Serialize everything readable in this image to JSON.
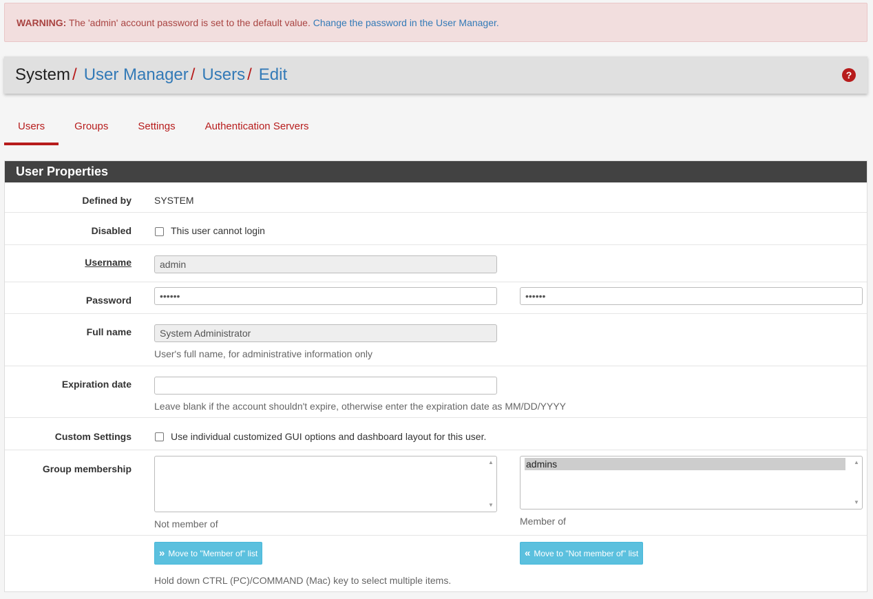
{
  "alert": {
    "prefix": "WARNING:",
    "message": " The 'admin' account password is set to the default value. ",
    "link": "Change the password in the User Manager."
  },
  "breadcrumb": {
    "root": "System",
    "sep": "/",
    "items": [
      "User Manager",
      "Users",
      "Edit"
    ]
  },
  "help_icon": "question-circle-icon",
  "tabs": [
    "Users",
    "Groups",
    "Settings",
    "Authentication Servers"
  ],
  "panel": {
    "title": "User Properties",
    "defined_by": {
      "label": "Defined by",
      "value": "SYSTEM"
    },
    "disabled": {
      "label": "Disabled",
      "checkbox_label": "This user cannot login",
      "checked": false
    },
    "username": {
      "label": "Username",
      "value": "admin"
    },
    "password": {
      "label": "Password",
      "value": "••••••",
      "confirm": "••••••"
    },
    "full_name": {
      "label": "Full name",
      "value": "System Administrator",
      "help": "User's full name, for administrative information only"
    },
    "expiration": {
      "label": "Expiration date",
      "value": "",
      "help": "Leave blank if the account shouldn't expire, otherwise enter the expiration date as MM/DD/YYYY"
    },
    "custom_settings": {
      "label": "Custom Settings",
      "checkbox_label": "Use individual customized GUI options and dashboard layout for this user.",
      "checked": false
    },
    "group_membership": {
      "label": "Group membership",
      "not_member_of": [],
      "not_member_label": "Not member of",
      "member_of": [
        "admins"
      ],
      "member_label": "Member of"
    },
    "move_to_member": "Move to \"Member of\" list",
    "move_to_not_member": "Move to \"Not member of\" list",
    "multi_select_help": "Hold down CTRL (PC)/COMMAND (Mac) key to select multiple items."
  },
  "colors": {
    "brand": "#b71c1c",
    "link": "#337ab7",
    "info_button": "#5bc0de",
    "panel_heading": "#424242"
  }
}
